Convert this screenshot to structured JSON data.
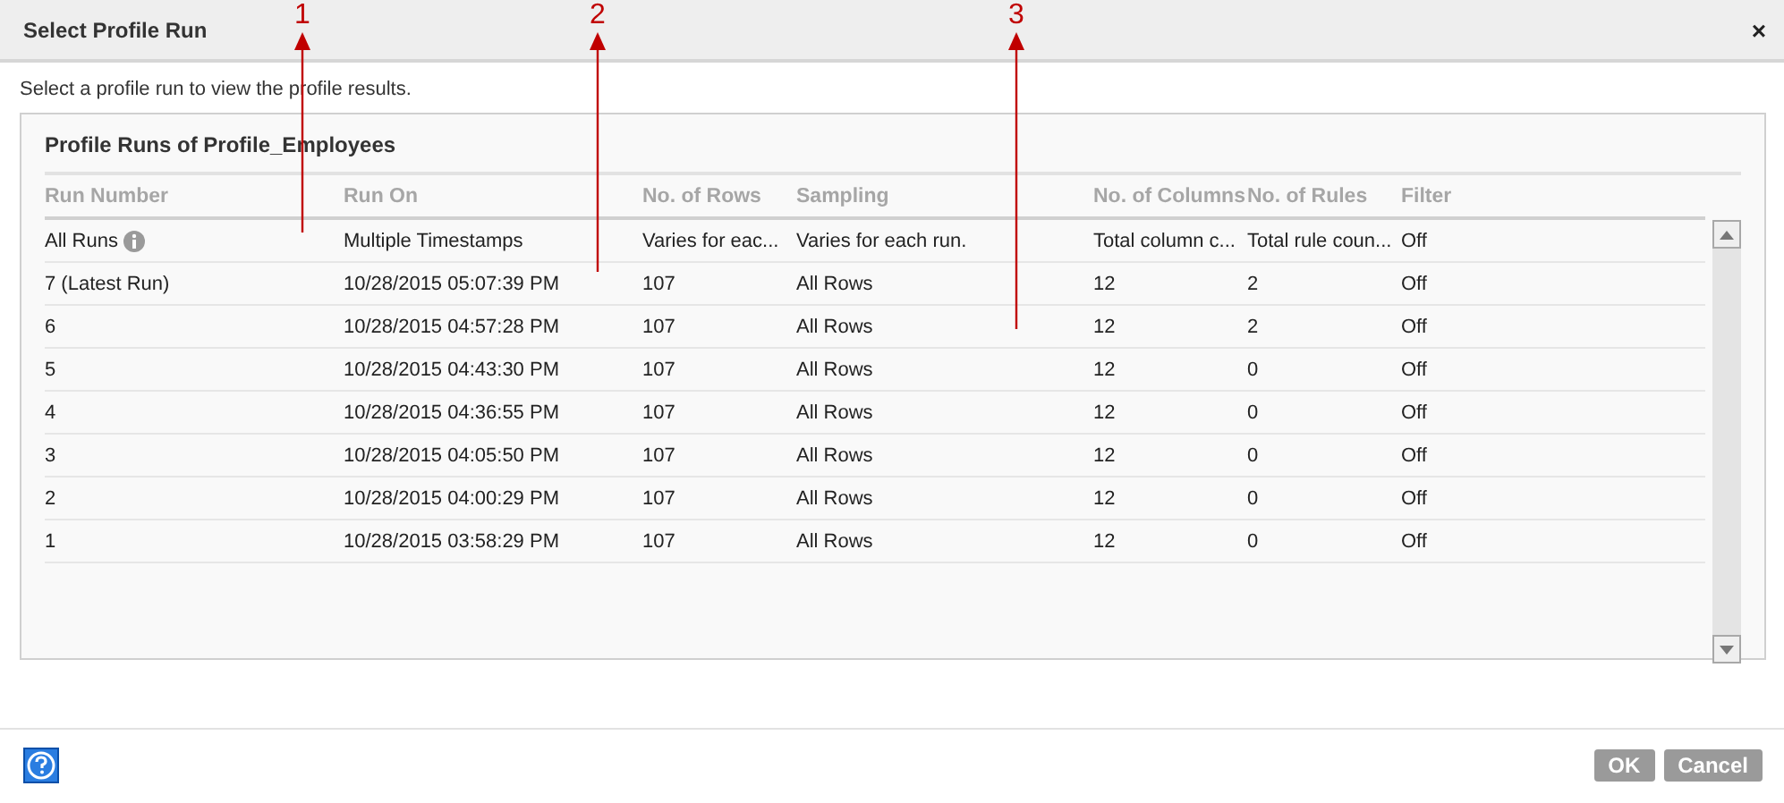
{
  "window": {
    "title": "Select Profile Run",
    "close": "×"
  },
  "description": "Select a profile run to view the profile results.",
  "panel": {
    "title": "Profile Runs of Profile_Employees"
  },
  "table": {
    "columns": [
      "Run Number",
      "Run On",
      "No. of Rows",
      "Sampling",
      "No. of Columns",
      "No. of Rules",
      "Filter"
    ],
    "rows": [
      {
        "info_icon": true,
        "cells": [
          "All Runs",
          "Multiple Timestamps",
          "Varies for eac...",
          "Varies for each run.",
          "Total column c...",
          "Total rule coun...",
          "Off"
        ]
      },
      {
        "info_icon": false,
        "cells": [
          "7 (Latest Run)",
          "10/28/2015 05:07:39 PM",
          "107",
          "All Rows",
          "12",
          "2",
          "Off"
        ]
      },
      {
        "info_icon": false,
        "cells": [
          "6",
          "10/28/2015 04:57:28 PM",
          "107",
          "All Rows",
          "12",
          "2",
          "Off"
        ]
      },
      {
        "info_icon": false,
        "cells": [
          "5",
          "10/28/2015 04:43:30 PM",
          "107",
          "All Rows",
          "12",
          "0",
          "Off"
        ]
      },
      {
        "info_icon": false,
        "cells": [
          "4",
          "10/28/2015 04:36:55 PM",
          "107",
          "All Rows",
          "12",
          "0",
          "Off"
        ]
      },
      {
        "info_icon": false,
        "cells": [
          "3",
          "10/28/2015 04:05:50 PM",
          "107",
          "All Rows",
          "12",
          "0",
          "Off"
        ]
      },
      {
        "info_icon": false,
        "cells": [
          "2",
          "10/28/2015 04:00:29 PM",
          "107",
          "All Rows",
          "12",
          "0",
          "Off"
        ]
      },
      {
        "info_icon": false,
        "cells": [
          "1",
          "10/28/2015 03:58:29 PM",
          "107",
          "All Rows",
          "12",
          "0",
          "Off"
        ]
      }
    ]
  },
  "buttons": [
    "OK",
    "Cancel"
  ],
  "callouts": [
    {
      "label": "1"
    },
    {
      "label": "2"
    },
    {
      "label": "3"
    }
  ]
}
